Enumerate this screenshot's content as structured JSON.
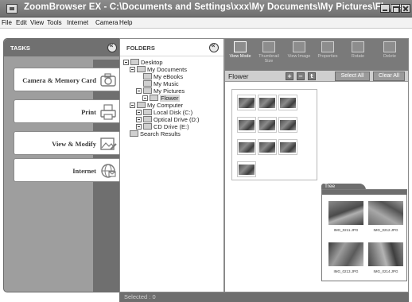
{
  "window": {
    "title": "ZoomBrowser EX  -  C:\\Documents and Settings\\xxx\\My Documents\\My Pictures\\Flower"
  },
  "menu": [
    "File",
    "Edit",
    "View",
    "Tools",
    "Internet",
    "Camera",
    "Help"
  ],
  "tasks": {
    "header": "TASKS",
    "items": [
      {
        "label": "Camera & Memory Card",
        "icon": "camera-icon"
      },
      {
        "label": "Print",
        "icon": "printer-icon"
      },
      {
        "label": "View & Modify",
        "icon": "view-modify-icon"
      },
      {
        "label": "Internet",
        "icon": "globe-icon"
      }
    ]
  },
  "folders": {
    "header": "FOLDERS",
    "tree": [
      {
        "label": "Desktop"
      },
      {
        "label": "My Documents"
      },
      {
        "label": "My eBooks"
      },
      {
        "label": "My Music"
      },
      {
        "label": "My Pictures"
      },
      {
        "label": "Flower",
        "selected": true
      },
      {
        "label": "My Computer"
      },
      {
        "label": "Local Disk (C:)"
      },
      {
        "label": "Optical Drive (D:)"
      },
      {
        "label": "CD Drive (E:)"
      },
      {
        "label": "Search Results"
      }
    ]
  },
  "browser": {
    "toolbar": [
      {
        "label": "View Mode",
        "icon": "view-mode-icon",
        "active": true
      },
      {
        "label": "Thumbnail Size",
        "icon": "thumbnail-size-icon"
      },
      {
        "label": "View Image",
        "icon": "view-image-icon"
      },
      {
        "label": "Properties",
        "icon": "properties-icon"
      },
      {
        "label": "Rotate",
        "icon": "rotate-icon"
      },
      {
        "label": "Delete",
        "icon": "delete-icon"
      }
    ],
    "location": "Flower",
    "select_all": "Select All",
    "clear_all": "Clear All"
  },
  "tree_window": {
    "title": "Tree",
    "thumbs": [
      {
        "caption": "IMG_0211.JPG"
      },
      {
        "caption": "IMG_0212.JPG"
      },
      {
        "caption": "IMG_0213.JPG"
      },
      {
        "caption": "IMG_0214.JPG"
      }
    ]
  },
  "status": {
    "text": "Selected : 0"
  }
}
